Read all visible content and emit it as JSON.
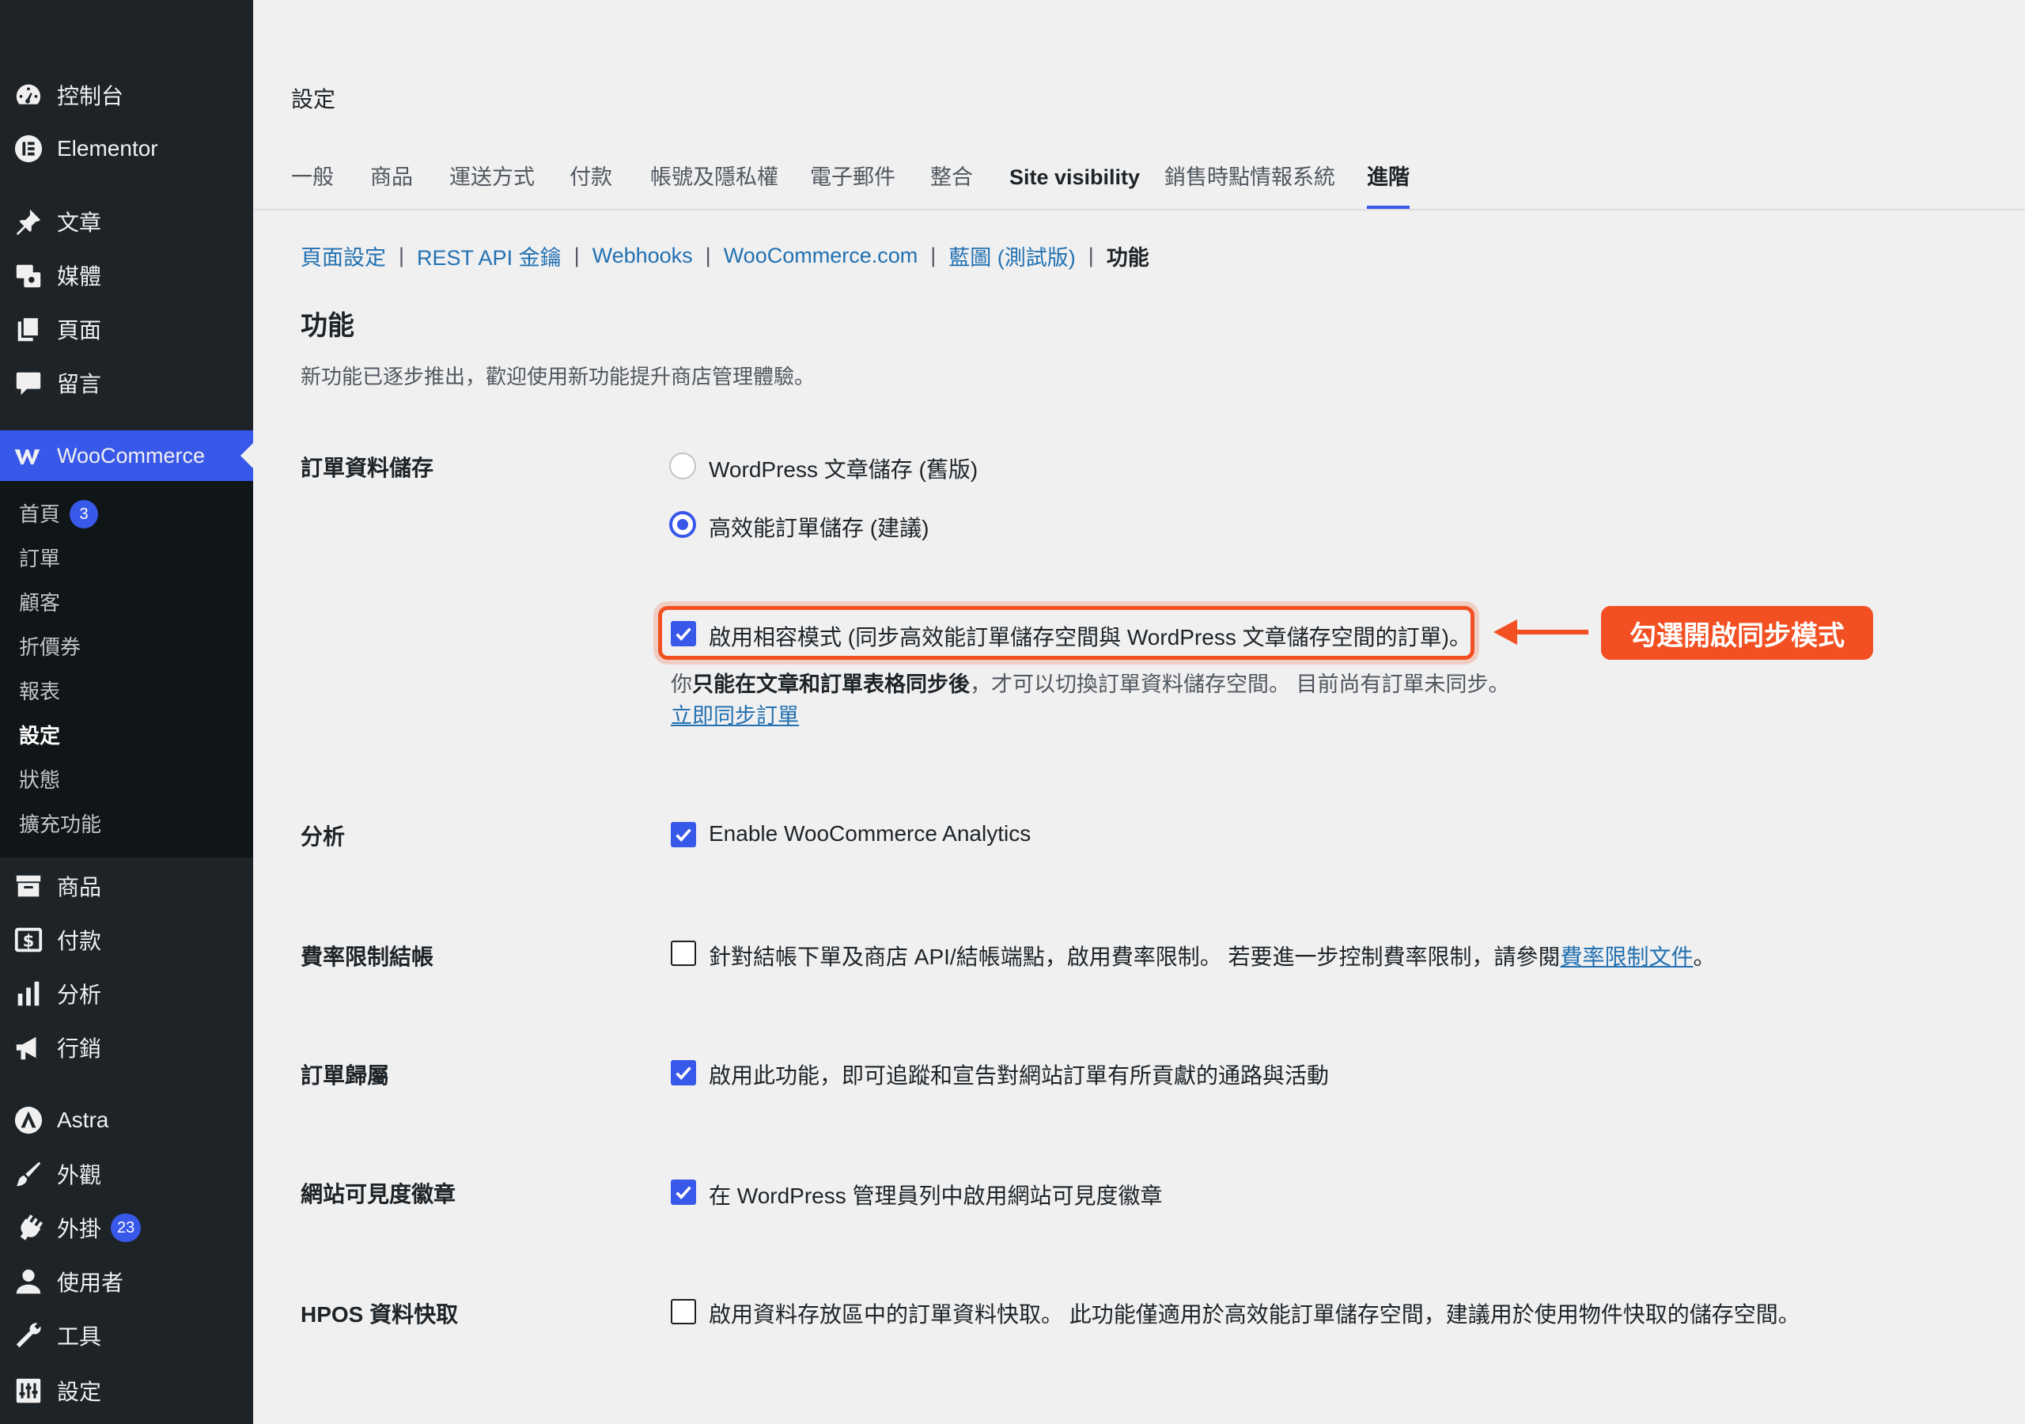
{
  "sidebar": {
    "items": [
      {
        "label": "控制台",
        "icon": "dashboard-icon"
      },
      {
        "label": "Elementor",
        "icon": "elementor-icon"
      },
      {
        "label": "文章",
        "icon": "pin-icon"
      },
      {
        "label": "媒體",
        "icon": "media-icon"
      },
      {
        "label": "頁面",
        "icon": "pages-icon"
      },
      {
        "label": "留言",
        "icon": "comment-icon"
      },
      {
        "label": "WooCommerce",
        "icon": "woocommerce-icon"
      },
      {
        "label": "商品",
        "icon": "archive-icon"
      },
      {
        "label": "付款",
        "icon": "money-icon"
      },
      {
        "label": "分析",
        "icon": "bar-chart-icon"
      },
      {
        "label": "行銷",
        "icon": "megaphone-icon"
      },
      {
        "label": "Astra",
        "icon": "astra-icon"
      },
      {
        "label": "外觀",
        "icon": "brush-icon"
      },
      {
        "label": "外掛",
        "icon": "plugin-icon",
        "badge": "23"
      },
      {
        "label": "使用者",
        "icon": "user-icon"
      },
      {
        "label": "工具",
        "icon": "wrench-icon"
      },
      {
        "label": "設定",
        "icon": "settings-icon"
      }
    ],
    "woo_submenu": [
      {
        "label": "首頁",
        "badge": "3"
      },
      {
        "label": "訂單"
      },
      {
        "label": "顧客"
      },
      {
        "label": "折價券"
      },
      {
        "label": "報表"
      },
      {
        "label": "設定",
        "current": true
      },
      {
        "label": "狀態"
      },
      {
        "label": "擴充功能"
      }
    ]
  },
  "header": {
    "title": "設定",
    "tabs": [
      "一般",
      "商品",
      "運送方式",
      "付款",
      "帳號及隱私權",
      "電子郵件",
      "整合",
      "Site visibility",
      "銷售時點情報系統",
      "進階"
    ],
    "active_tab": "進階"
  },
  "subsub": {
    "links": [
      "頁面設定",
      "REST API 金鑰",
      "Webhooks",
      "WooCommerce.com",
      "藍圖 (測試版)"
    ],
    "current": "功能"
  },
  "section": {
    "heading": "功能",
    "description": "新功能已逐步推出，歡迎使用新功能提升商店管理體驗。"
  },
  "settings": {
    "order_storage": {
      "label": "訂單資料儲存",
      "option_posts": "WordPress 文章儲存 (舊版)",
      "option_hpos": "高效能訂單儲存 (建議)",
      "selected": "hpos",
      "compat_label": "啟用相容模式 (同步高效能訂單儲存空間與 WordPress 文章儲存空間的訂單)。",
      "compat_checked": true,
      "hint_prefix": "你",
      "hint_bold": "只能在文章和訂單表格同步後",
      "hint_suffix": "，才可以切換訂單資料儲存空間。 目前尚有訂單未同步。",
      "sync_link": "立即同步訂單"
    },
    "analytics": {
      "label": "分析",
      "option": "Enable WooCommerce Analytics",
      "checked": true
    },
    "rate_limit": {
      "label": "費率限制結帳",
      "option": "針對結帳下單及商店 API/結帳端點，啟用費率限制。 若要進一步控制費率限制，請參閱",
      "link": "費率限制文件",
      "suffix": "。",
      "checked": false
    },
    "attribution": {
      "label": "訂單歸屬",
      "option": "啟用此功能，即可追蹤和宣告對網站訂單有所貢獻的通路與活動",
      "checked": true
    },
    "visibility_badge": {
      "label": "網站可見度徽章",
      "option": "在 WordPress 管理員列中啟用網站可見度徽章",
      "checked": true
    },
    "hpos_cache": {
      "label": "HPOS 資料快取",
      "option": "啟用資料存放區中的訂單資料快取。 此功能僅適用於高效能訂單儲存空間，建議用於使用物件快取的儲存空間。",
      "checked": false
    }
  },
  "annotation": {
    "callout_text": "勾選開啟同步模式",
    "color": "#f25022"
  },
  "colors": {
    "sidebar_bg": "#1d2327",
    "accent": "#3858e9",
    "link": "#2271b1"
  }
}
